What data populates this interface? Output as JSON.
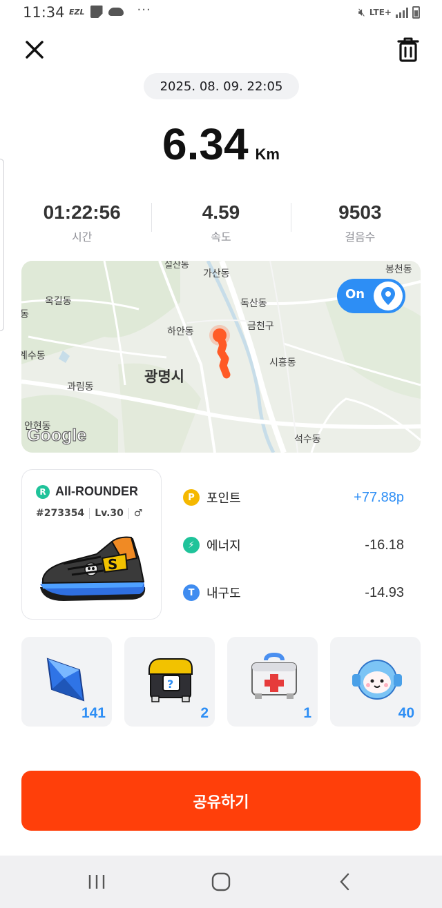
{
  "status_bar": {
    "time": "11:34",
    "ezl": "EZL",
    "dots": "···",
    "network": "LTE+",
    "icons": [
      "ezl-icon",
      "note-icon",
      "cloud-icon",
      "more-icon",
      "mute-icon",
      "signal-icon",
      "battery-icon"
    ]
  },
  "header": {
    "close_icon": "close-icon",
    "delete_icon": "trash-icon"
  },
  "activity": {
    "datetime": "2025. 08. 09. 22:05",
    "distance": "6.34",
    "distance_unit": "Km",
    "stats": [
      {
        "value": "01:22:56",
        "label": "시간"
      },
      {
        "value": "4.59",
        "label": "속도"
      },
      {
        "value": "9503",
        "label": "걸음수"
      }
    ]
  },
  "map": {
    "labels": [
      "가산동",
      "봉천동",
      "옥길동",
      "독산동",
      "금천구",
      "하안동",
      "광명시",
      "시흥동",
      "과림동",
      "석수동",
      "안현동",
      "설산동",
      "계수동",
      "동"
    ],
    "toggle_label": "On",
    "toggle_icon": "location-pin-icon",
    "attribution": "Google",
    "route_color": "#ff5a26"
  },
  "shoe": {
    "type_badge": "R",
    "name": "All-ROUNDER",
    "id": "#273354",
    "level": "Lv.30",
    "gender_symbol": "♂",
    "type_color": "#1fc39a"
  },
  "rewards": [
    {
      "icon": "P",
      "label": "포인트",
      "value": "+77.88p",
      "color": "#f5b800"
    },
    {
      "icon": "⚡",
      "label": "에너지",
      "value": "-16.18",
      "color": "#1fc39a"
    },
    {
      "icon": "T",
      "label": "내구도",
      "value": "-14.93",
      "color": "#3f8cf0"
    }
  ],
  "items": [
    {
      "name": "crystal-icon",
      "count": "141"
    },
    {
      "name": "mystery-box-icon",
      "count": "2"
    },
    {
      "name": "first-aid-kit-icon",
      "count": "1"
    },
    {
      "name": "mascot-icon",
      "count": "40"
    }
  ],
  "share_label": "공유하기",
  "accent_color": "#ff3f0a"
}
